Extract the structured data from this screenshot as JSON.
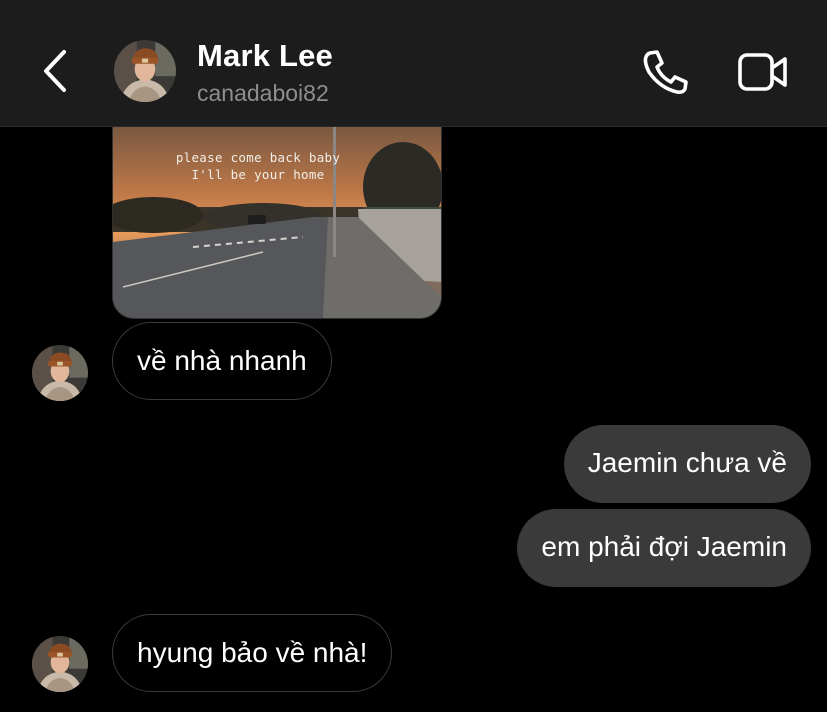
{
  "header": {
    "contact_name": "Mark Lee",
    "username": "canadaboi82",
    "icons": [
      "back-chevron-icon",
      "avatar",
      "phone-icon",
      "video-camera-icon"
    ]
  },
  "photo_message": {
    "caption_line1": "please come back baby",
    "caption_line2": "I'll be your home"
  },
  "messages": [
    {
      "direction": "in",
      "text": "về nhà nhanh"
    },
    {
      "direction": "out",
      "text": "Jaemin chưa về"
    },
    {
      "direction": "out",
      "text": "em phải đợi Jaemin"
    },
    {
      "direction": "in",
      "text": "hyung bảo về nhà!"
    }
  ],
  "colors": {
    "background": "#000000",
    "header_bg": "#1c1c1c",
    "outgoing_bubble": "#3a3a3a",
    "incoming_border": "#3a3a3a",
    "secondary_text": "#8e8e8e"
  }
}
